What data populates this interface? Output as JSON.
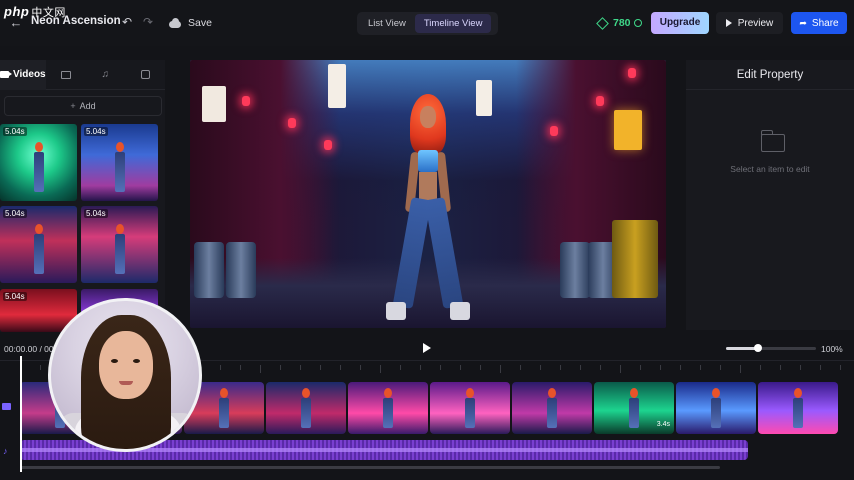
{
  "watermark": {
    "text": "php",
    "cn": "中文网"
  },
  "header": {
    "project_title": "Neon Ascension",
    "save_label": "Save",
    "views": [
      "List View",
      "Timeline View"
    ],
    "active_view": "Timeline View",
    "credits": "780",
    "upgrade_label": "Upgrade",
    "preview_label": "Preview",
    "share_label": "Share"
  },
  "left_panel": {
    "tabs": [
      {
        "label": "Videos",
        "icon": "video-icon",
        "active": true
      },
      {
        "label": "",
        "icon": "image-icon",
        "active": false
      },
      {
        "label": "",
        "icon": "music-icon",
        "active": false
      },
      {
        "label": "",
        "icon": "sticker-icon",
        "active": false
      }
    ],
    "add_label": "Add",
    "media": [
      {
        "duration": "5.04s"
      },
      {
        "duration": "5.04s"
      },
      {
        "duration": "5.04s"
      },
      {
        "duration": "5.04s"
      },
      {
        "duration": "5.04s"
      },
      {
        "duration": ""
      }
    ]
  },
  "right_panel": {
    "title": "Edit Property",
    "empty_text": "Select an item to edit"
  },
  "playback": {
    "time": "00:00.00 / 00",
    "zoom_label": "100%",
    "zoom_fraction": 0.35
  },
  "timeline": {
    "clips": [
      {
        "duration": ""
      },
      {
        "duration": ""
      },
      {
        "duration": ""
      },
      {
        "duration": ""
      },
      {
        "duration": ""
      },
      {
        "duration": ""
      },
      {
        "duration": ""
      },
      {
        "duration": "3.4s"
      },
      {
        "duration": ""
      },
      {
        "duration": ""
      }
    ]
  },
  "colors": {
    "accent": "#1d56f0",
    "credit": "#3fd98a",
    "audio": "#7a3fd0"
  }
}
